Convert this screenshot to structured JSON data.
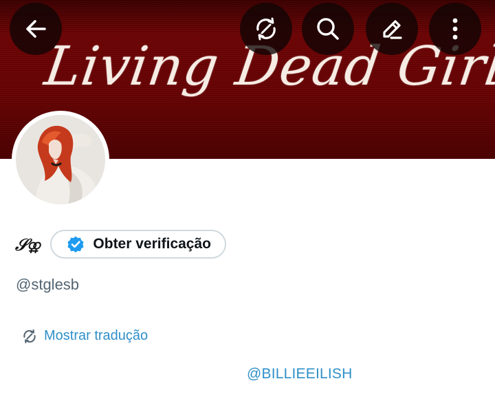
{
  "header": {
    "banner_text": "Living Dead Girl",
    "buttons": {
      "back_icon": "arrow-left-icon",
      "translate_icon": "translate-icon",
      "search_icon": "search-icon",
      "edit_icon": "pencil-icon",
      "more_icon": "more-vertical-icon"
    },
    "banner_color": "#640203"
  },
  "profile": {
    "display_name": "𝒮⚢",
    "verify_button_label": "Obter verificação",
    "verify_badge_color": "#1d9bf0",
    "handle": "@stglesb",
    "translate_label": "Mostrar tradução",
    "bio_mention": "@BILLIEEILISH"
  },
  "colors": {
    "link": "#2f8fc9",
    "secondary_text": "#536471",
    "primary_text": "#0f1419"
  }
}
